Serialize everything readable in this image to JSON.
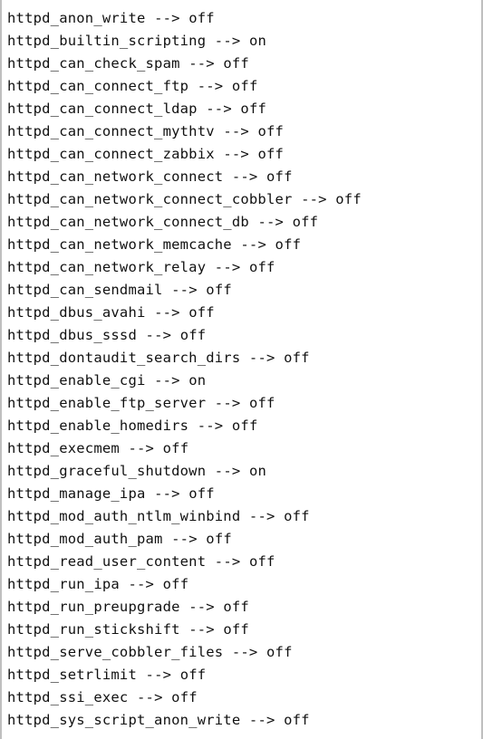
{
  "booleans": [
    {
      "name": "httpd_anon_write",
      "value": "off"
    },
    {
      "name": "httpd_builtin_scripting",
      "value": "on"
    },
    {
      "name": "httpd_can_check_spam",
      "value": "off"
    },
    {
      "name": "httpd_can_connect_ftp",
      "value": "off"
    },
    {
      "name": "httpd_can_connect_ldap",
      "value": "off"
    },
    {
      "name": "httpd_can_connect_mythtv",
      "value": "off"
    },
    {
      "name": "httpd_can_connect_zabbix",
      "value": "off"
    },
    {
      "name": "httpd_can_network_connect",
      "value": "off"
    },
    {
      "name": "httpd_can_network_connect_cobbler",
      "value": "off"
    },
    {
      "name": "httpd_can_network_connect_db",
      "value": "off"
    },
    {
      "name": "httpd_can_network_memcache",
      "value": "off"
    },
    {
      "name": "httpd_can_network_relay",
      "value": "off"
    },
    {
      "name": "httpd_can_sendmail",
      "value": "off"
    },
    {
      "name": "httpd_dbus_avahi",
      "value": "off"
    },
    {
      "name": "httpd_dbus_sssd",
      "value": "off"
    },
    {
      "name": "httpd_dontaudit_search_dirs",
      "value": "off"
    },
    {
      "name": "httpd_enable_cgi",
      "value": "on"
    },
    {
      "name": "httpd_enable_ftp_server",
      "value": "off"
    },
    {
      "name": "httpd_enable_homedirs",
      "value": "off"
    },
    {
      "name": "httpd_execmem",
      "value": "off"
    },
    {
      "name": "httpd_graceful_shutdown",
      "value": "on"
    },
    {
      "name": "httpd_manage_ipa",
      "value": "off"
    },
    {
      "name": "httpd_mod_auth_ntlm_winbind",
      "value": "off"
    },
    {
      "name": "httpd_mod_auth_pam",
      "value": "off"
    },
    {
      "name": "httpd_read_user_content",
      "value": "off"
    },
    {
      "name": "httpd_run_ipa",
      "value": "off"
    },
    {
      "name": "httpd_run_preupgrade",
      "value": "off"
    },
    {
      "name": "httpd_run_stickshift",
      "value": "off"
    },
    {
      "name": "httpd_serve_cobbler_files",
      "value": "off"
    },
    {
      "name": "httpd_setrlimit",
      "value": "off"
    },
    {
      "name": "httpd_ssi_exec",
      "value": "off"
    },
    {
      "name": "httpd_sys_script_anon_write",
      "value": "off"
    }
  ],
  "arrow": "-->"
}
